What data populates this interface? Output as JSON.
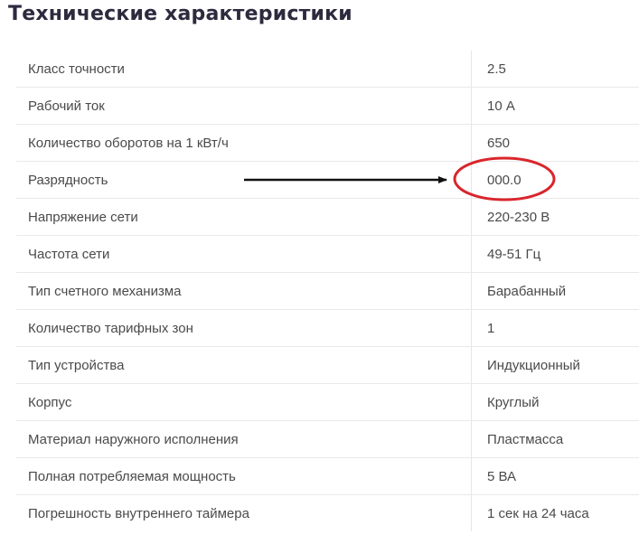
{
  "section": {
    "title": "Технические характеристики"
  },
  "specs": [
    {
      "label": "Класс точности",
      "value": "2.5"
    },
    {
      "label": "Рабочий ток",
      "value": "10 А"
    },
    {
      "label": "Количество оборотов на 1 кВт/ч",
      "value": "650"
    },
    {
      "label": "Разрядность",
      "value": "000.0"
    },
    {
      "label": "Напряжение сети",
      "value": "220-230 В"
    },
    {
      "label": "Частота сети",
      "value": "49-51 Гц"
    },
    {
      "label": "Тип счетного механизма",
      "value": "Барабанный"
    },
    {
      "label": "Количество тарифных зон",
      "value": "1"
    },
    {
      "label": "Тип устройства",
      "value": "Индукционный"
    },
    {
      "label": "Корпус",
      "value": "Круглый"
    },
    {
      "label": "Материал наружного исполнения",
      "value": "Пластмасса"
    },
    {
      "label": "Полная потребляемая мощность",
      "value": "5 ВА"
    },
    {
      "label": "Погрешность внутреннего таймера",
      "value": "1 сек на 24 часа"
    }
  ],
  "annotation": {
    "highlight_color": "#d9262c",
    "arrow_color": "#111111"
  }
}
